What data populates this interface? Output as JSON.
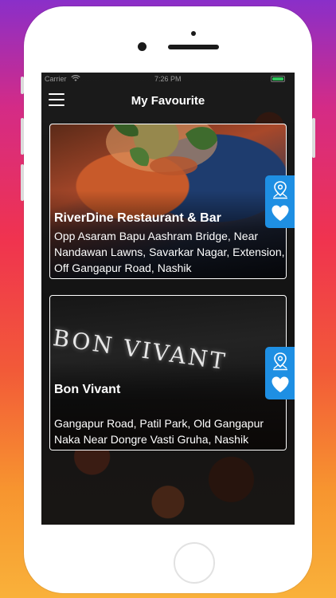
{
  "status_bar": {
    "carrier": "Carrier",
    "wifi_icon": "wifi-icon",
    "time": "7:26 PM",
    "battery_level": 1.0,
    "battery_color": "#2ec45a"
  },
  "navbar": {
    "menu_icon": "hamburger-menu-icon",
    "title": "My Favourite"
  },
  "favorites": [
    {
      "name": "RiverDine Restaurant & Bar",
      "address": "Opp Asaram Bapu Aashram Bridge, Near Nandawan Lawns, Savarkar Nagar, Extension, Off Gangapur Road, Nashik",
      "map_icon": "map-pin-icon",
      "fav_icon": "heart-icon"
    },
    {
      "name": "Bon Vivant",
      "sign_text": "BON VIVANT",
      "address": "Gangapur Road, Patil Park, Old Gangapur Naka Near Dongre Vasti Gruha, Nashik",
      "map_icon": "map-pin-icon",
      "fav_icon": "heart-icon"
    }
  ],
  "colors": {
    "accent": "#1e8fe3",
    "card_border": "#ffffff",
    "text": "#ffffff"
  }
}
